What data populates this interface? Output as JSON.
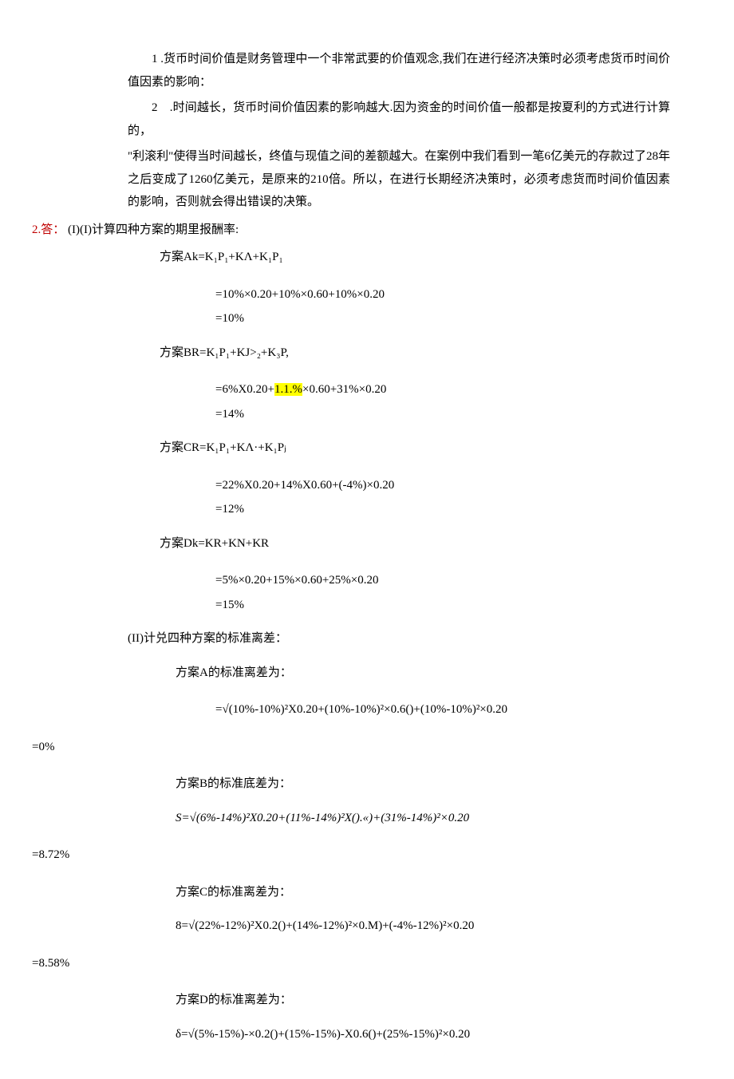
{
  "intro": {
    "p1": "1 .货币时间价值是财务管理中一个非常武要的价值观念,我们在进行经济决策时必须考虑货币时间价值因素的影响：",
    "p2a": "2　.时间越长，货币时间价值因素的影响越大.因为资金的时间价值一般都是按夏利的方式进行计算的，",
    "p2b": "\"利滚利\"使得当时间越长，终值与现值之间的差额越大。在案例中我们看到一笔6亿美元的存款过了28年之后变成了1260亿美元，是原来的210倍。所以，在进行长期经济决策时，必须考虑货而时间价值因素的影响，否则就会得出错误的决策。"
  },
  "ans": {
    "label": "2.答：",
    "i_title": "(I)(I)计算四种方案的期里报酬率:"
  },
  "A": {
    "t": "方案Ak=K₁P₁+KΛ+K₁P₁",
    "f1": "=10%×0.20+10%×0.60+10%×0.20",
    "f2": "=10%"
  },
  "B": {
    "t": "方案BR=K₁P₁+KJ>₂+K₃P,",
    "f1a": "=6%X0.20+",
    "f1m": "1.1.%",
    "f1b": "×0.60+31%×0.20",
    "f2": "=14%"
  },
  "C": {
    "t": "方案CR=K₁P₁+KΛ·+K₁Pⱼ",
    "f1": "=22%X0.20+14%X0.60+(-4%)×0.20",
    "f2": "=12%"
  },
  "D": {
    "t": "方案Dk=KR+KN+KR",
    "f1": "=5%×0.20+15%×0.60+25%×0.20",
    "f2": "=15%"
  },
  "ii_title": "(II)计兑四种方案的标准离差：",
  "sA": {
    "t": "方案A的标准离差为：",
    "f": "=√(10%-10%)²X0.20+(10%-10%)²×0.6()+(10%-10%)²×0.20",
    "r": "=0%"
  },
  "sB": {
    "t": "方案B的标准底差为：",
    "f": "S=√(6%-14%)²X0.20+(11%-14%)²X().«)+(31%-14%)²×0.20",
    "r": "=8.72%"
  },
  "sC": {
    "t": "方案C的标准离差为：",
    "f": "8=√(22%-12%)²X0.2()+(14%-12%)²×0.M)+(-4%-12%)²×0.20",
    "r": "=8.58%"
  },
  "sD": {
    "t": "方案D的标准离差为：",
    "f": "δ=√(5%-15%)-×0.2()+(15%-15%)-X0.6()+(25%-15%)²×0.20"
  }
}
